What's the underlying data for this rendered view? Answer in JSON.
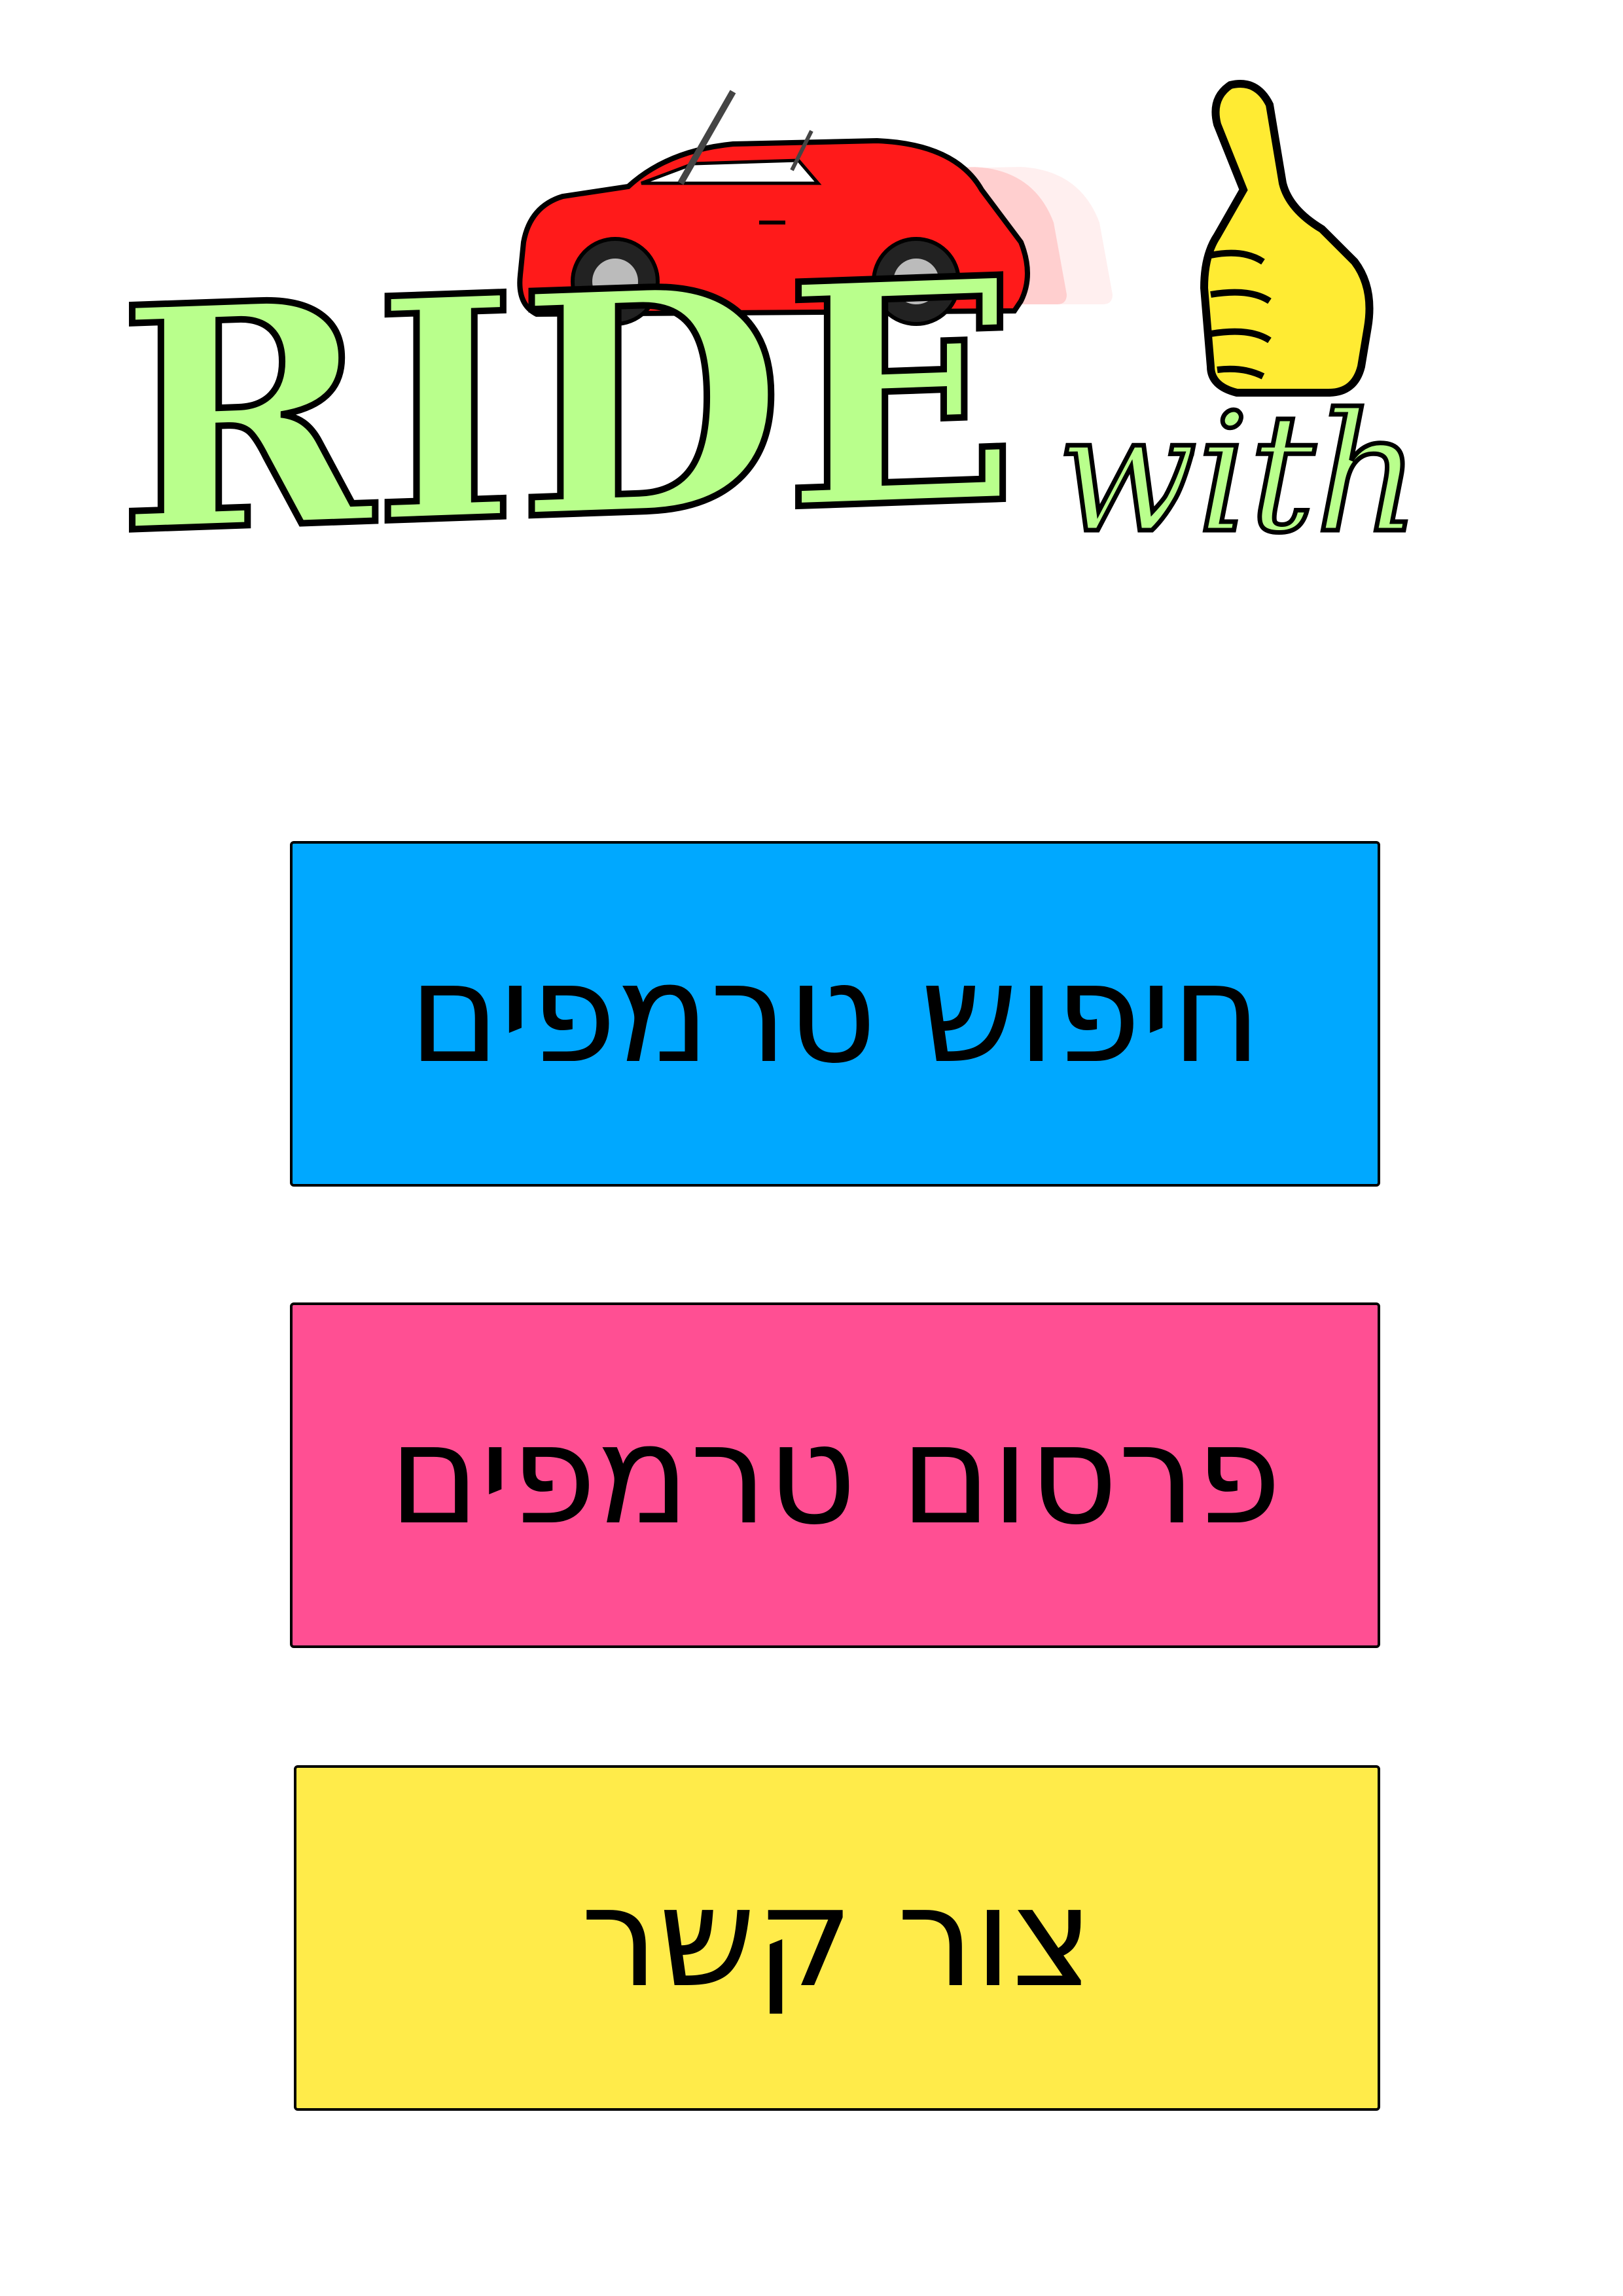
{
  "logo": {
    "main_text": "RIDE",
    "sub_text": "with"
  },
  "menu": {
    "buttons": [
      {
        "label": "חיפוש טרמפים",
        "color": "#00a8ff"
      },
      {
        "label": "פרסום טרמפים",
        "color": "#ff4f93"
      },
      {
        "label": "צור קשר",
        "color": "#ffeb4a"
      }
    ]
  },
  "colors": {
    "logo_text_fill": "#b9ff8c",
    "car_body": "#ff1a1a",
    "thumb_fill": "#ffeb33"
  }
}
